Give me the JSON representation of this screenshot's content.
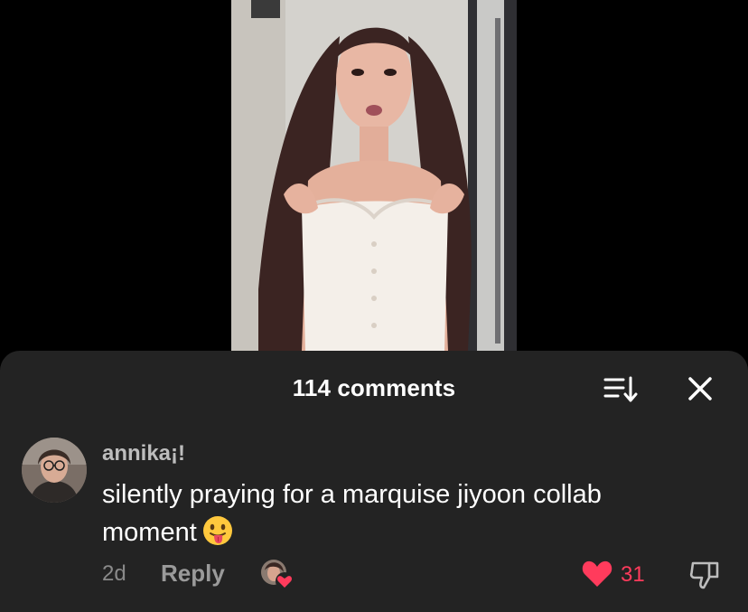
{
  "sheet": {
    "title": "114 comments",
    "sort_icon": "sort-icon",
    "close_icon": "close-icon"
  },
  "comment": {
    "username": "annika¡!",
    "text": "silently praying for a marquise jiyoon collab moment",
    "emoji": "tongue-out-emoji",
    "timestamp": "2d",
    "reply_label": "Reply",
    "like_count": "31",
    "liked": true,
    "creator_liked": true
  },
  "colors": {
    "sheet_bg": "#232323",
    "like_red": "#ff3b5c",
    "muted_text": "#8a8a8a"
  }
}
